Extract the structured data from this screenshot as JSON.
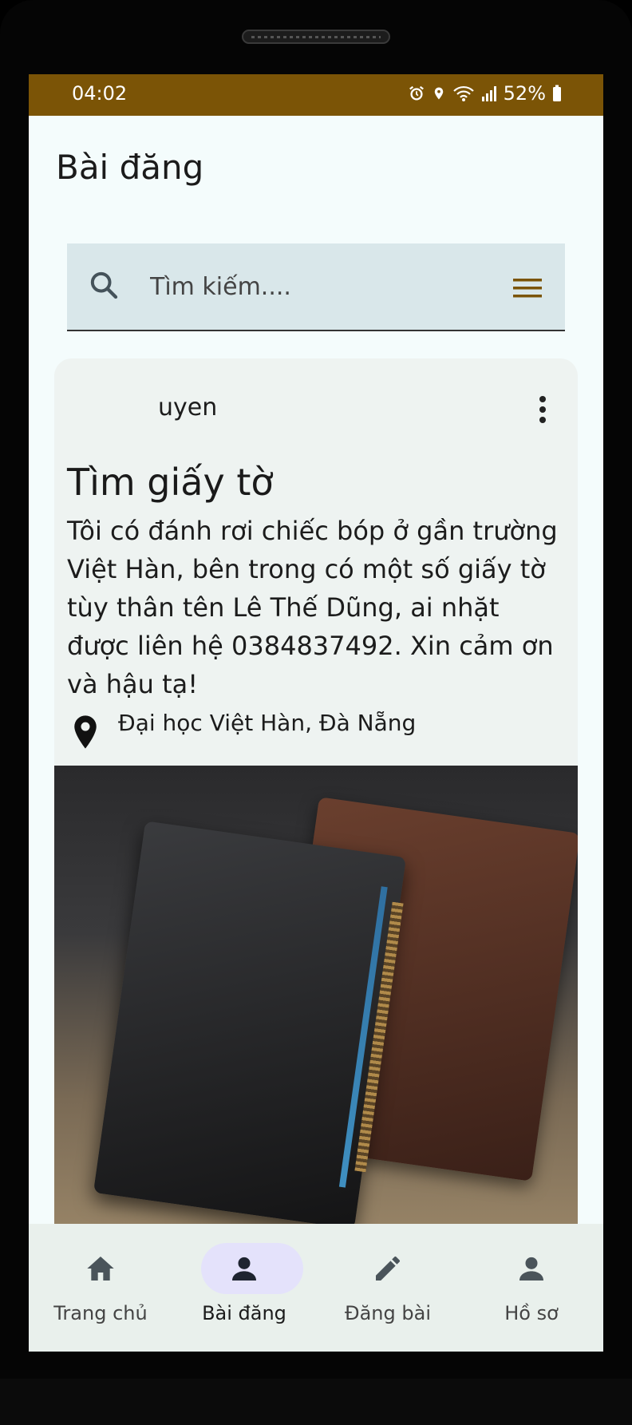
{
  "status_bar": {
    "time": "04:02",
    "battery": "52%"
  },
  "app_bar": {
    "title": "Bài đăng"
  },
  "search": {
    "placeholder": "Tìm kiếm...."
  },
  "post": {
    "username": "uyen",
    "title": "Tìm giấy tờ",
    "body": "Tôi có đánh rơi chiếc bóp ở gần trường Việt Hàn, bên trong có một số giấy tờ tùy thân tên Lê Thế Dũng, ai nhặt được liên hệ 0384837492. Xin cảm ơn và hậu tạ!",
    "location": "Đại học Việt Hàn, Đà Nẵng"
  },
  "nav": {
    "items": [
      {
        "label": "Trang chủ",
        "icon": "home-icon"
      },
      {
        "label": "Bài đăng",
        "icon": "person-icon",
        "active": true
      },
      {
        "label": "Đăng bài",
        "icon": "pencil-icon"
      },
      {
        "label": "Hồ sơ",
        "icon": "person-icon"
      }
    ]
  },
  "colors": {
    "status_bar": "#7b5406",
    "accent": "#7b5406",
    "active_pill": "#e4e2fb"
  }
}
